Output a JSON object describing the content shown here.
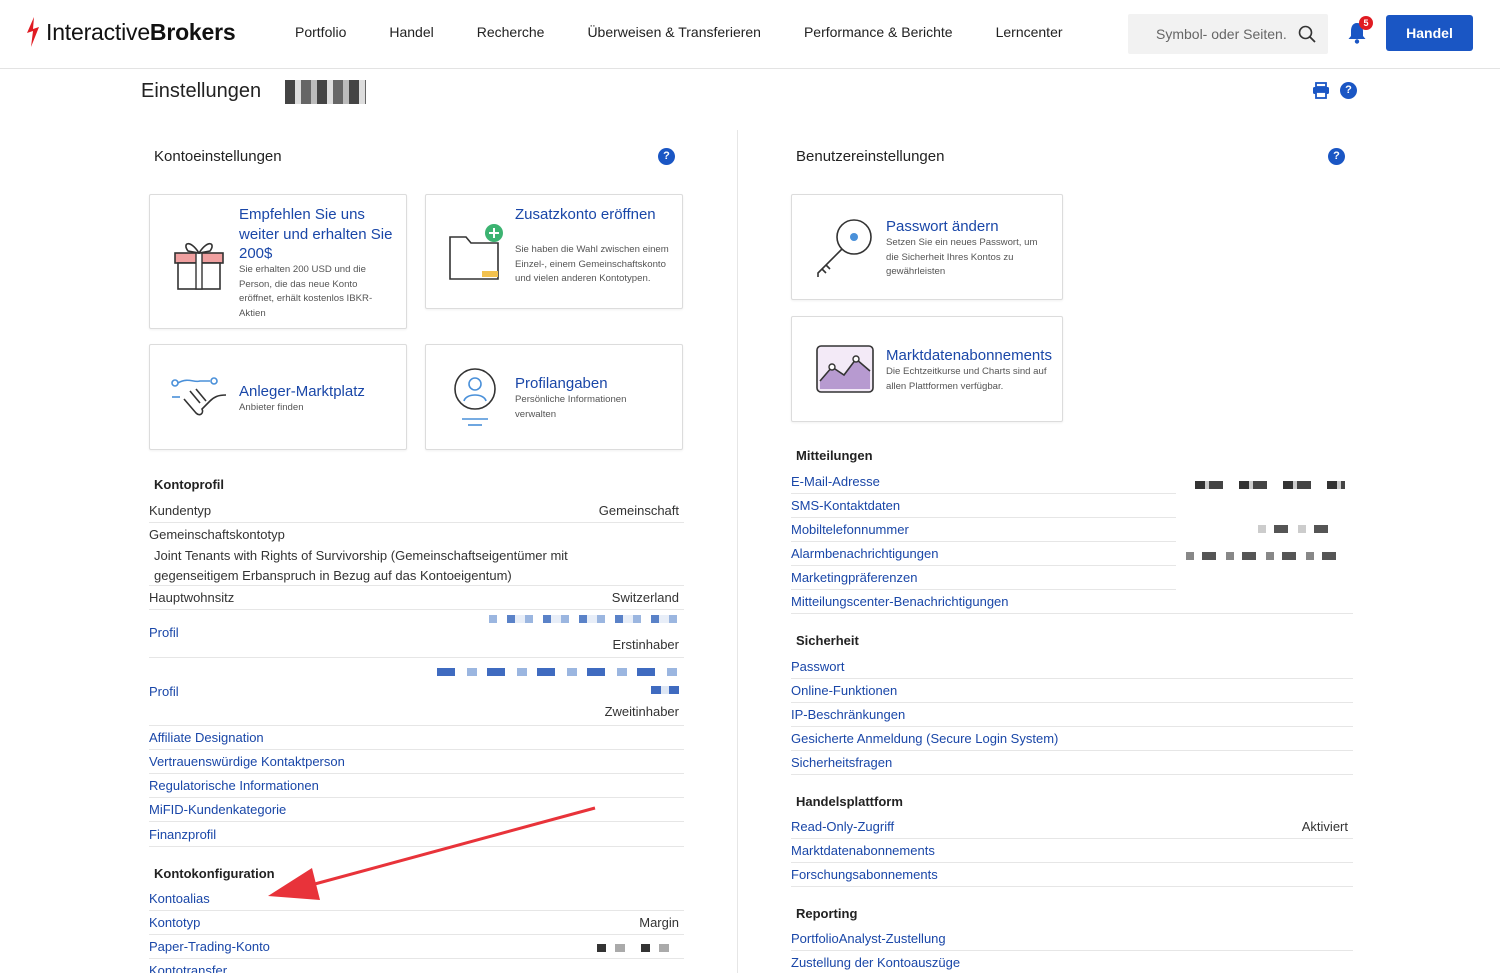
{
  "brand": {
    "name_regular": "Interactive",
    "name_bold": "Brokers",
    "accent": "#e01b22"
  },
  "nav": [
    "Portfolio",
    "Handel",
    "Recherche",
    "Überweisen & Transferieren",
    "Performance & Berichte",
    "Lerncenter"
  ],
  "search": {
    "placeholder": "Symbol- oder Seiten..."
  },
  "notifications": {
    "count": "5"
  },
  "trade_button": "Handel",
  "page_title": "Einstellungen",
  "left": {
    "heading": "Kontoeinstellungen",
    "cards": [
      {
        "title": "Empfehlen Sie uns weiter und erhalten Sie 200$",
        "desc": "Sie erhalten 200 USD und die Person, die das neue Konto eröffnet, erhält kostenlos IBKR-Aktien"
      },
      {
        "title": "Zusatzkonto eröffnen",
        "desc": "Sie haben die Wahl zwischen einem Einzel-, einem Gemeinschaftskonto und vielen anderen Kontotypen."
      },
      {
        "title": "Anleger-Marktplatz",
        "desc": "Anbieter finden"
      },
      {
        "title": "Profilangaben",
        "desc": "Persönliche Informationen verwalten"
      }
    ],
    "profile": {
      "heading": "Kontoprofil",
      "kundentyp": {
        "label": "Kundentyp",
        "value": "Gemeinschaft"
      },
      "gk_label": "Gemeinschaftskontotyp",
      "gk_value": "Joint Tenants with Rights of Survivorship (Gemeinschaftseigentümer mit gegenseitigem Erbanspruch in Bezug auf das Kontoeigentum)",
      "hauptwohnsitz": {
        "label": "Hauptwohnsitz",
        "value": "Switzerland"
      },
      "profil1": {
        "label": "Profil",
        "value": "Erstinhaber"
      },
      "profil2": {
        "label": "Profil",
        "value": "Zweitinhaber"
      },
      "links": [
        "Affiliate Designation",
        "Vertrauenswürdige Kontaktperson",
        "Regulatorische Informationen",
        "MiFID-Kundenkategorie",
        "Finanzprofil"
      ]
    },
    "config": {
      "heading": "Kontokonfiguration",
      "alias": "Kontoalias",
      "kontotyp": {
        "label": "Kontotyp",
        "value": "Margin"
      },
      "paper": "Paper-Trading-Konto",
      "transfer": "Kontotransfer"
    }
  },
  "right": {
    "heading": "Benutzereinstellungen",
    "cards": [
      {
        "title": "Passwort ändern",
        "desc": "Setzen Sie ein neues Passwort, um die Sicherheit Ihres Kontos zu gewährleisten"
      },
      {
        "title": "Marktdatenabonnements",
        "desc": "Die Echtzeitkurse und Charts sind auf allen Plattformen verfügbar."
      }
    ],
    "mitteilungen": {
      "heading": "Mitteilungen",
      "links": [
        "E-Mail-Adresse",
        "SMS-Kontaktdaten",
        "Mobiltelefonnummer",
        "Alarmbenachrichtigungen",
        "Marketingpräferenzen",
        "Mitteilungscenter-Benachrichtigungen"
      ]
    },
    "sicherheit": {
      "heading": "Sicherheit",
      "links": [
        "Passwort",
        "Online-Funktionen",
        "IP-Beschränkungen",
        "Gesicherte Anmeldung (Secure Login System)",
        "Sicherheitsfragen"
      ]
    },
    "handelsplattform": {
      "heading": "Handelsplattform",
      "readonly": {
        "label": "Read-Only-Zugriff",
        "value": "Aktiviert"
      },
      "links": [
        "Marktdatenabonnements",
        "Forschungsabonnements"
      ]
    },
    "reporting": {
      "heading": "Reporting",
      "links": [
        "PortfolioAnalyst-Zustellung",
        "Zustellung der Kontoauszüge"
      ]
    }
  }
}
